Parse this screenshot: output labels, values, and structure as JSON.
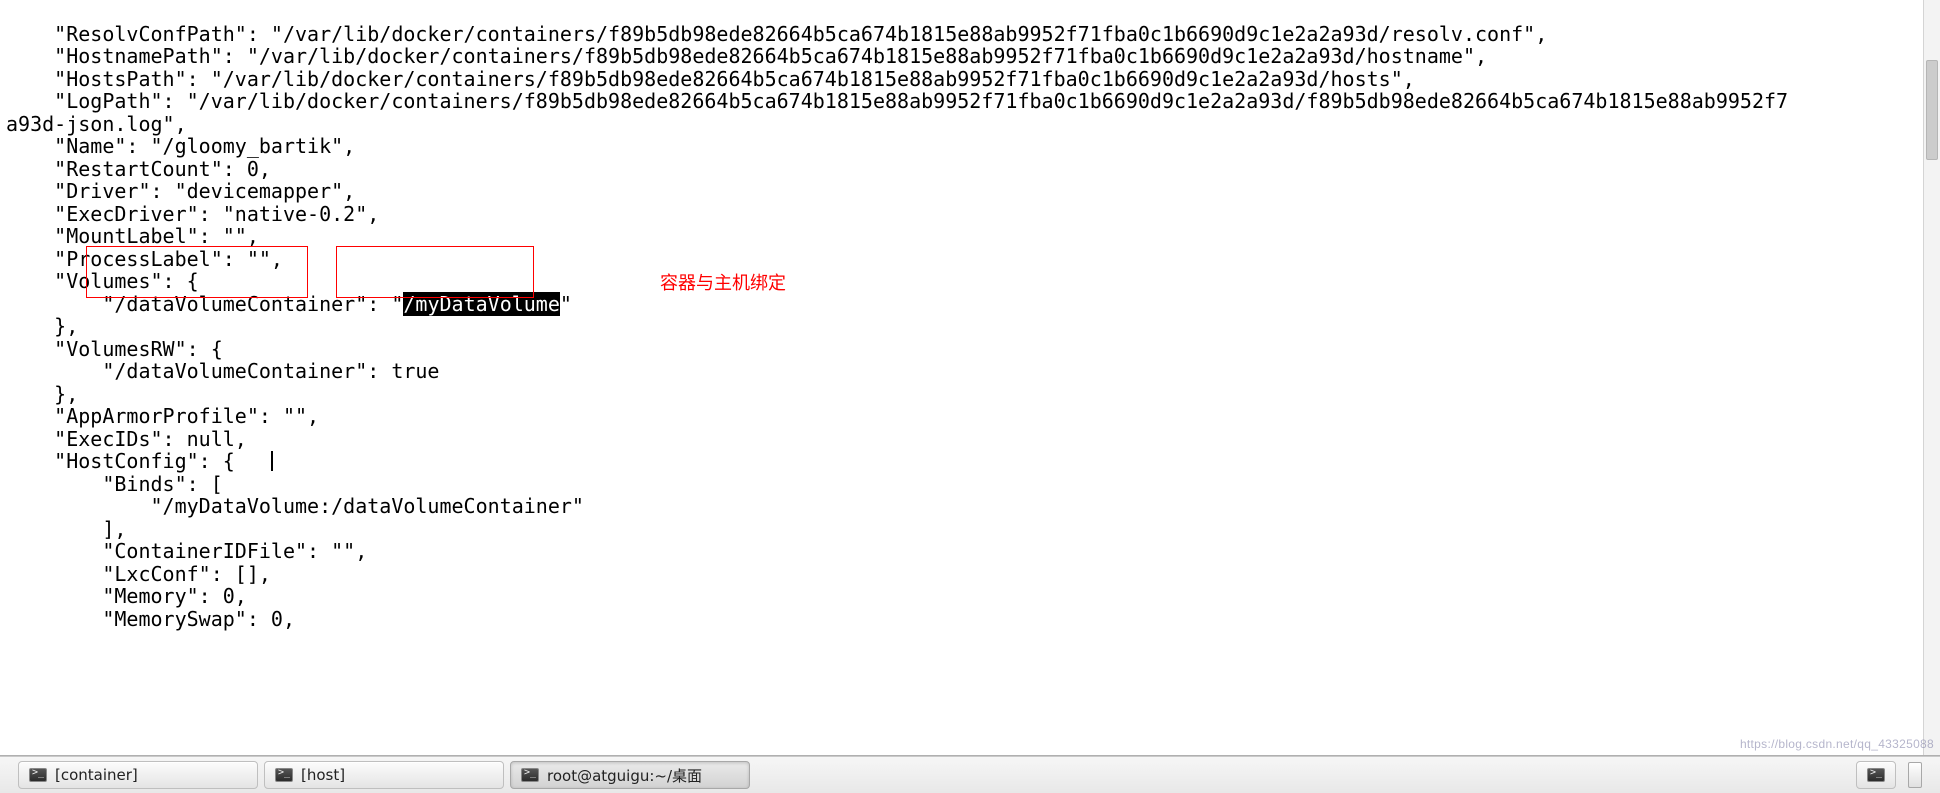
{
  "terminal": {
    "lines": [
      "    \"ResolvConfPath\": \"/var/lib/docker/containers/f89b5db98ede82664b5ca674b1815e88ab9952f71fba0c1b6690d9c1e2a2a93d/resolv.conf\",",
      "    \"HostnamePath\": \"/var/lib/docker/containers/f89b5db98ede82664b5ca674b1815e88ab9952f71fba0c1b6690d9c1e2a2a93d/hostname\",",
      "    \"HostsPath\": \"/var/lib/docker/containers/f89b5db98ede82664b5ca674b1815e88ab9952f71fba0c1b6690d9c1e2a2a93d/hosts\",",
      "    \"LogPath\": \"/var/lib/docker/containers/f89b5db98ede82664b5ca674b1815e88ab9952f71fba0c1b6690d9c1e2a2a93d/f89b5db98ede82664b5ca674b1815e88ab9952f7",
      "a93d-json.log\",",
      "    \"Name\": \"/gloomy_bartik\",",
      "    \"RestartCount\": 0,",
      "    \"Driver\": \"devicemapper\",",
      "    \"ExecDriver\": \"native-0.2\",",
      "    \"MountLabel\": \"\",",
      "    \"ProcessLabel\": \"\","
    ],
    "volumes_key": "    \"Volumes\": {",
    "volumes_line_pre": "        \"/dataVolumeContainer\": \"",
    "volumes_sel": "/myDataVolume",
    "volumes_post": "\"",
    "volumes_close": "    },",
    "linesB": [
      "    \"VolumesRW\": {",
      "        \"/dataVolumeContainer\": true",
      "    },",
      "    \"AppArmorProfile\": \"\",",
      "    \"ExecIDs\": null,"
    ],
    "hostconfig_line": "    \"HostConfig\": {   ",
    "linesC": [
      "        \"Binds\": [",
      "            \"/myDataVolume:/dataVolumeContainer\"",
      "        ],",
      "        \"ContainerIDFile\": \"\",",
      "        \"LxcConf\": [],",
      "        \"Memory\": 0,",
      "        \"MemorySwap\": 0,"
    ]
  },
  "annotation": {
    "label": "容器与主机绑定"
  },
  "taskbar": {
    "items": [
      {
        "label": "[container]",
        "icon": "terminal",
        "active": false
      },
      {
        "label": "[host]",
        "icon": "terminal",
        "active": false
      },
      {
        "label": "root@atguigu:~/桌面",
        "icon": "terminal",
        "active": true
      }
    ],
    "tray_icon": "terminal"
  },
  "watermark": "https://blog.csdn.net/qq_43325088"
}
